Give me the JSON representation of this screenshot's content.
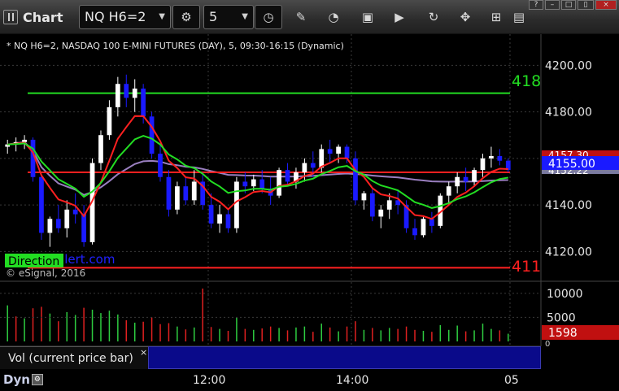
{
  "toolbar": {
    "app_title": "Chart",
    "symbol": "NQ H6=2",
    "interval": "5"
  },
  "chart": {
    "header": "* NQ H6=2, NASDAQ 100 E-MINI FUTURES (DAY), 5, 09:30-16:15 (Dynamic)",
    "copyright": "© eSignal, 2016",
    "watermark_label": "Direction",
    "watermark_text": "alert.com",
    "level_high_label": "418",
    "level_low_label": "411",
    "price_badge_1": "4157.30",
    "price_badge_current": "4155.00",
    "price_badge_2": "4152.22",
    "price_ticks": [
      "4200.00",
      "4180.00",
      "4160.00",
      "4140.00",
      "4120.00"
    ],
    "volume_ticks": [
      "10000",
      "5000"
    ],
    "volume_badge": "1598",
    "volume_zero": "0",
    "colors": {
      "up_candle": "#ffffff",
      "down_candle": "#1a1aff",
      "fast_ma": "#ff2020",
      "slow_ma": "#22dd22",
      "vwap": "#9a7fc0",
      "level_high": "#22dd22",
      "level_low": "#ff2020",
      "vol_up": "#2ecc40",
      "vol_down": "#e02020"
    }
  },
  "volume_panel": {
    "study_label": "Vol (current price bar)",
    "close_glyph": "×"
  },
  "bottom": {
    "dyn_label": "Dyn",
    "time_labels": [
      "12:00",
      "14:00",
      "05"
    ]
  },
  "chart_data": {
    "type": "candlestick",
    "price_axis": {
      "min": 4110,
      "max": 4205,
      "ticks": [
        4200,
        4180,
        4160,
        4140,
        4120
      ]
    },
    "levels": [
      {
        "value": 4188,
        "label": "418",
        "color": "#22dd22"
      },
      {
        "value": 4113,
        "label": "411",
        "color": "#ff2020"
      },
      {
        "value": 4154,
        "label": "",
        "color": "#ff2020"
      }
    ],
    "candles": [
      [
        4165,
        4168,
        4162,
        4166
      ],
      [
        4166,
        4169,
        4163,
        4167
      ],
      [
        4167,
        4170,
        4164,
        4168
      ],
      [
        4168,
        4169,
        4150,
        4152
      ],
      [
        4152,
        4153,
        4125,
        4128
      ],
      [
        4128,
        4135,
        4122,
        4134
      ],
      [
        4134,
        4140,
        4128,
        4130
      ],
      [
        4130,
        4142,
        4126,
        4138
      ],
      [
        4138,
        4145,
        4132,
        4136
      ],
      [
        4136,
        4140,
        4122,
        4124
      ],
      [
        4124,
        4160,
        4123,
        4158
      ],
      [
        4158,
        4172,
        4155,
        4170
      ],
      [
        4170,
        4185,
        4168,
        4182
      ],
      [
        4182,
        4195,
        4178,
        4192
      ],
      [
        4192,
        4196,
        4182,
        4186
      ],
      [
        4186,
        4194,
        4180,
        4190
      ],
      [
        4190,
        4192,
        4175,
        4178
      ],
      [
        4178,
        4180,
        4160,
        4162
      ],
      [
        4162,
        4166,
        4150,
        4152
      ],
      [
        4152,
        4155,
        4135,
        4138
      ],
      [
        4138,
        4150,
        4136,
        4148
      ],
      [
        4148,
        4152,
        4140,
        4142
      ],
      [
        4142,
        4155,
        4140,
        4150
      ],
      [
        4150,
        4154,
        4138,
        4140
      ],
      [
        4140,
        4145,
        4130,
        4132
      ],
      [
        4132,
        4140,
        4128,
        4136
      ],
      [
        4136,
        4138,
        4128,
        4130
      ],
      [
        4130,
        4152,
        4128,
        4150
      ],
      [
        4150,
        4154,
        4145,
        4148
      ],
      [
        4148,
        4153,
        4146,
        4151
      ],
      [
        4151,
        4155,
        4145,
        4147
      ],
      [
        4147,
        4152,
        4140,
        4144
      ],
      [
        4144,
        4156,
        4143,
        4155
      ],
      [
        4155,
        4158,
        4148,
        4150
      ],
      [
        4150,
        4156,
        4147,
        4154
      ],
      [
        4154,
        4160,
        4150,
        4158
      ],
      [
        4158,
        4163,
        4152,
        4156
      ],
      [
        4156,
        4166,
        4154,
        4164
      ],
      [
        4164,
        4168,
        4158,
        4162
      ],
      [
        4162,
        4166,
        4158,
        4165
      ],
      [
        4165,
        4166,
        4158,
        4160
      ],
      [
        4160,
        4163,
        4140,
        4142
      ],
      [
        4142,
        4146,
        4138,
        4145
      ],
      [
        4145,
        4147,
        4133,
        4135
      ],
      [
        4135,
        4140,
        4130,
        4138
      ],
      [
        4138,
        4145,
        4134,
        4142
      ],
      [
        4142,
        4146,
        4136,
        4140
      ],
      [
        4140,
        4142,
        4128,
        4130
      ],
      [
        4130,
        4134,
        4125,
        4127
      ],
      [
        4127,
        4135,
        4126,
        4134
      ],
      [
        4134,
        4137,
        4128,
        4131
      ],
      [
        4131,
        4145,
        4130,
        4144
      ],
      [
        4144,
        4150,
        4140,
        4148
      ],
      [
        4148,
        4154,
        4145,
        4152
      ],
      [
        4152,
        4156,
        4146,
        4150
      ],
      [
        4150,
        4156,
        4148,
        4155
      ],
      [
        4155,
        4162,
        4152,
        4160
      ],
      [
        4160,
        4165,
        4156,
        4161
      ],
      [
        4161,
        4164,
        4157,
        4159
      ],
      [
        4159,
        4160,
        4154,
        4155
      ]
    ],
    "volume": [
      [
        7500,
        1
      ],
      [
        5200,
        0
      ],
      [
        4800,
        1
      ],
      [
        6900,
        0
      ],
      [
        7200,
        0
      ],
      [
        5800,
        1
      ],
      [
        4200,
        0
      ],
      [
        6100,
        1
      ],
      [
        5500,
        1
      ],
      [
        7000,
        0
      ],
      [
        6600,
        1
      ],
      [
        5900,
        1
      ],
      [
        6400,
        1
      ],
      [
        5600,
        1
      ],
      [
        4400,
        0
      ],
      [
        3900,
        1
      ],
      [
        4100,
        0
      ],
      [
        5000,
        0
      ],
      [
        3600,
        0
      ],
      [
        3800,
        0
      ],
      [
        3100,
        1
      ],
      [
        2500,
        0
      ],
      [
        2900,
        1
      ],
      [
        11000,
        0
      ],
      [
        3000,
        0
      ],
      [
        2600,
        1
      ],
      [
        2200,
        0
      ],
      [
        4900,
        1
      ],
      [
        2600,
        0
      ],
      [
        2400,
        1
      ],
      [
        2700,
        0
      ],
      [
        3100,
        0
      ],
      [
        2800,
        1
      ],
      [
        2300,
        0
      ],
      [
        2900,
        1
      ],
      [
        3100,
        1
      ],
      [
        2000,
        0
      ],
      [
        3700,
        1
      ],
      [
        2900,
        0
      ],
      [
        2100,
        1
      ],
      [
        3100,
        0
      ],
      [
        4200,
        0
      ],
      [
        2400,
        1
      ],
      [
        2800,
        0
      ],
      [
        2300,
        1
      ],
      [
        2800,
        1
      ],
      [
        2600,
        0
      ],
      [
        3100,
        0
      ],
      [
        2400,
        0
      ],
      [
        2200,
        1
      ],
      [
        2000,
        0
      ],
      [
        3400,
        1
      ],
      [
        2400,
        1
      ],
      [
        3300,
        1
      ],
      [
        2100,
        0
      ],
      [
        2300,
        1
      ],
      [
        3700,
        1
      ],
      [
        2600,
        1
      ],
      [
        2300,
        0
      ],
      [
        1598,
        1
      ]
    ],
    "volume_axis": {
      "min": 0,
      "max": 11500,
      "ticks": [
        10000,
        5000
      ]
    }
  }
}
